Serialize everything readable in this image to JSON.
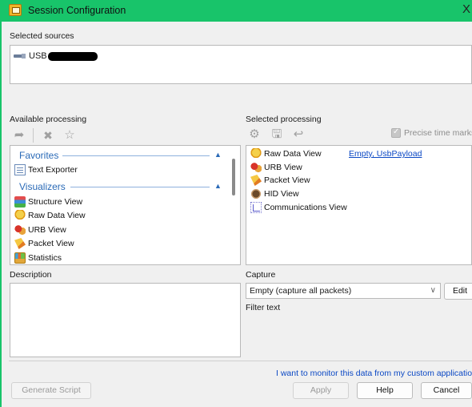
{
  "window": {
    "title": "Session Configuration",
    "close_glyph": "X",
    "accent": "#18c46a"
  },
  "selected_sources": {
    "label": "Selected sources",
    "items": [
      {
        "icon": "usb-icon",
        "label": "USB"
      }
    ]
  },
  "available_processing": {
    "label": "Available processing",
    "toolbar": [
      {
        "icon": "forward-arrow-icon"
      },
      {
        "icon": "delete-x-icon"
      },
      {
        "icon": "star-icon"
      }
    ],
    "groups": [
      {
        "title": "Favorites",
        "items": [
          {
            "icon": "text-exporter-icon",
            "label": "Text Exporter"
          }
        ]
      },
      {
        "title": "Visualizers",
        "items": [
          {
            "icon": "structure-view-icon",
            "label": "Structure View"
          },
          {
            "icon": "raw-data-view-icon",
            "label": "Raw Data View"
          },
          {
            "icon": "urb-view-icon",
            "label": "URB View"
          },
          {
            "icon": "packet-view-icon",
            "label": "Packet View"
          },
          {
            "icon": "statistics-icon",
            "label": "Statistics"
          }
        ]
      }
    ]
  },
  "selected_processing": {
    "label": "Selected processing",
    "toolbar": [
      {
        "icon": "gear-icon"
      },
      {
        "icon": "save-icon"
      },
      {
        "icon": "undo-arrow-icon"
      }
    ],
    "precise_time_marks": {
      "label": "Precise time marks",
      "checked": true,
      "enabled": false
    },
    "items": [
      {
        "icon": "raw-data-view-icon",
        "label": "Raw Data View",
        "filter": "Empty, UsbPayload"
      },
      {
        "icon": "urb-view-icon",
        "label": "URB View"
      },
      {
        "icon": "packet-view-icon",
        "label": "Packet View"
      },
      {
        "icon": "hid-view-icon",
        "label": "HID View"
      },
      {
        "icon": "communications-view-icon",
        "label": "Communications View"
      }
    ]
  },
  "description": {
    "label": "Description",
    "value": ""
  },
  "capture": {
    "label": "Capture",
    "selected": "Empty (capture all packets)",
    "edit_label": "Edit",
    "filter_text_label": "Filter text"
  },
  "footer": {
    "monitor_link": "I want to monitor this data from my custom applicatio",
    "generate_script": "Generate Script",
    "apply": "Apply",
    "help": "Help",
    "cancel": "Cancel"
  }
}
